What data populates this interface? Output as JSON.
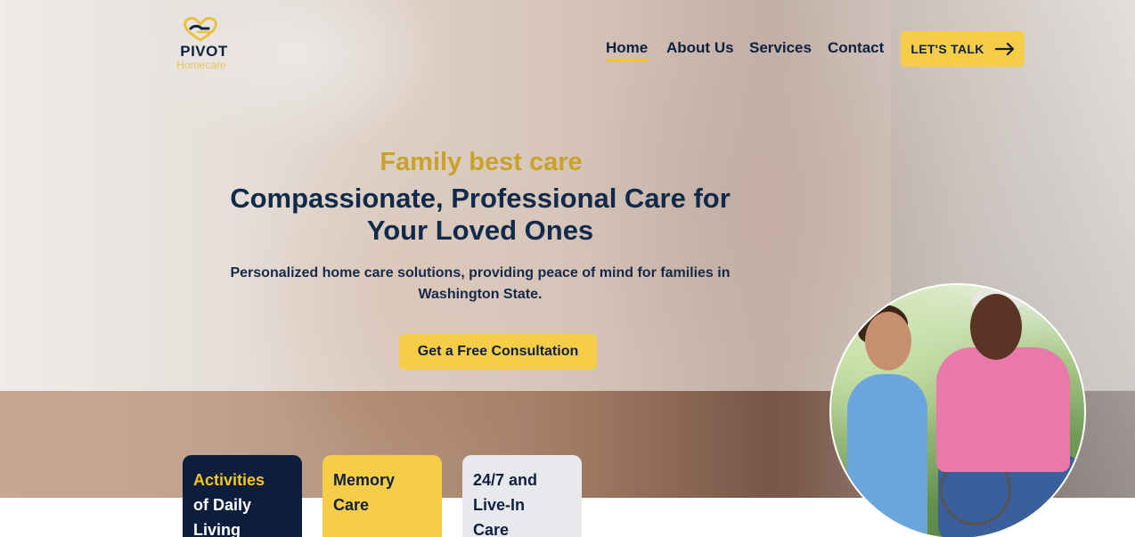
{
  "brand": {
    "name": "PIVOT",
    "tagline": "Homecare"
  },
  "nav": {
    "items": [
      "Home",
      "About Us",
      "Services",
      "Contact"
    ],
    "active": "Home",
    "cta_label": "LET'S TALK"
  },
  "hero": {
    "kicker": "Family best care",
    "headline_line1": "Compassionate, Professional Care for",
    "headline_line2": "Your Loved Ones",
    "subtext_line1": "Personalized home care solutions, providing peace of mind for families in",
    "subtext_line2": "Washington State.",
    "button_label": "Get a Free Consultation"
  },
  "cards": [
    {
      "title_accent": "Activities",
      "title_rest_1": "of Daily",
      "title_rest_2": "Living"
    },
    {
      "title_1": "Memory",
      "title_2": "Care"
    },
    {
      "title_1": "24/7 and",
      "title_2": "Live-In",
      "title_3": "Care"
    }
  ],
  "colors": {
    "navy": "#0f2040",
    "gold": "#f5cd47",
    "kicker_gold": "#c9a328",
    "card_navy": "#0d1d3c",
    "card_light": "#e8e9ec"
  },
  "icons": {
    "logo": "heart-hands-icon",
    "cta_arrow": "arrow-right-icon"
  }
}
